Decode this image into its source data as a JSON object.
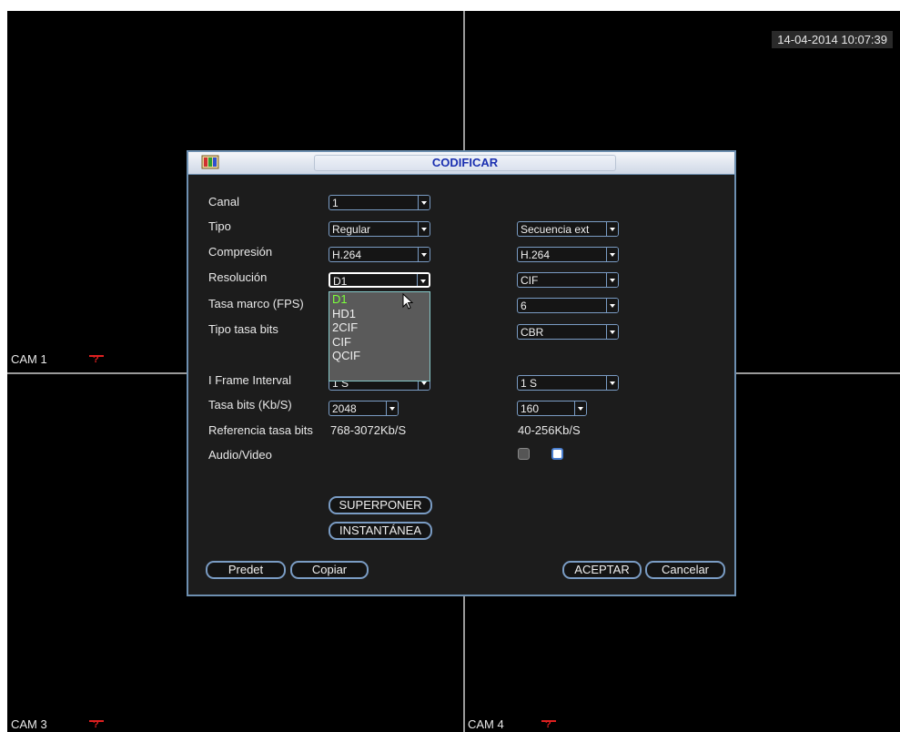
{
  "datetime": "14-04-2014 10:07:39",
  "cameras": {
    "cam1": "CAM 1",
    "cam3": "CAM 3",
    "cam4": "CAM 4",
    "alert_symbol": "?"
  },
  "dialog": {
    "title": "CODIFICAR",
    "labels": {
      "canal": "Canal",
      "tipo": "Tipo",
      "compresion": "Compresión",
      "resolucion": "Resolución",
      "tasa_marco": "Tasa marco (FPS)",
      "tipo_tasa_bits": "Tipo tasa bits",
      "i_frame_interval": "I Frame Interval",
      "tasa_bits": "Tasa bits (Kb/S)",
      "referencia_tasa_bits": "Referencia tasa bits",
      "audio_video": "Audio/Video"
    },
    "main": {
      "canal": "1",
      "tipo": "Regular",
      "compresion": "H.264",
      "resolucion": "D1",
      "i_frame_interval": "1 S",
      "tasa_bits": "2048",
      "referencia": "768-3072Kb/S"
    },
    "extra": {
      "tipo": "Secuencia ext",
      "compresion": "H.264",
      "resolucion": "CIF",
      "tasa_marco": "6",
      "tipo_tasa_bits": "CBR",
      "i_frame_interval": "1 S",
      "tasa_bits": "160",
      "referencia": "40-256Kb/S",
      "audio_checked": false,
      "video_checked": true
    },
    "resolution_options": [
      "D1",
      "HD1",
      "2CIF",
      "CIF",
      "QCIF"
    ],
    "buttons": {
      "superponer": "SUPERPONER",
      "instantanea": "INSTANTÁNEA",
      "predet": "Predet",
      "copiar": "Copiar",
      "aceptar": "ACEPTAR",
      "cancelar": "Cancelar"
    }
  },
  "colors": {
    "accent_border": "#7a9cc4",
    "title_text": "#1a2fb0",
    "selected_option": "#7cff3c",
    "alert": "#e02020"
  }
}
